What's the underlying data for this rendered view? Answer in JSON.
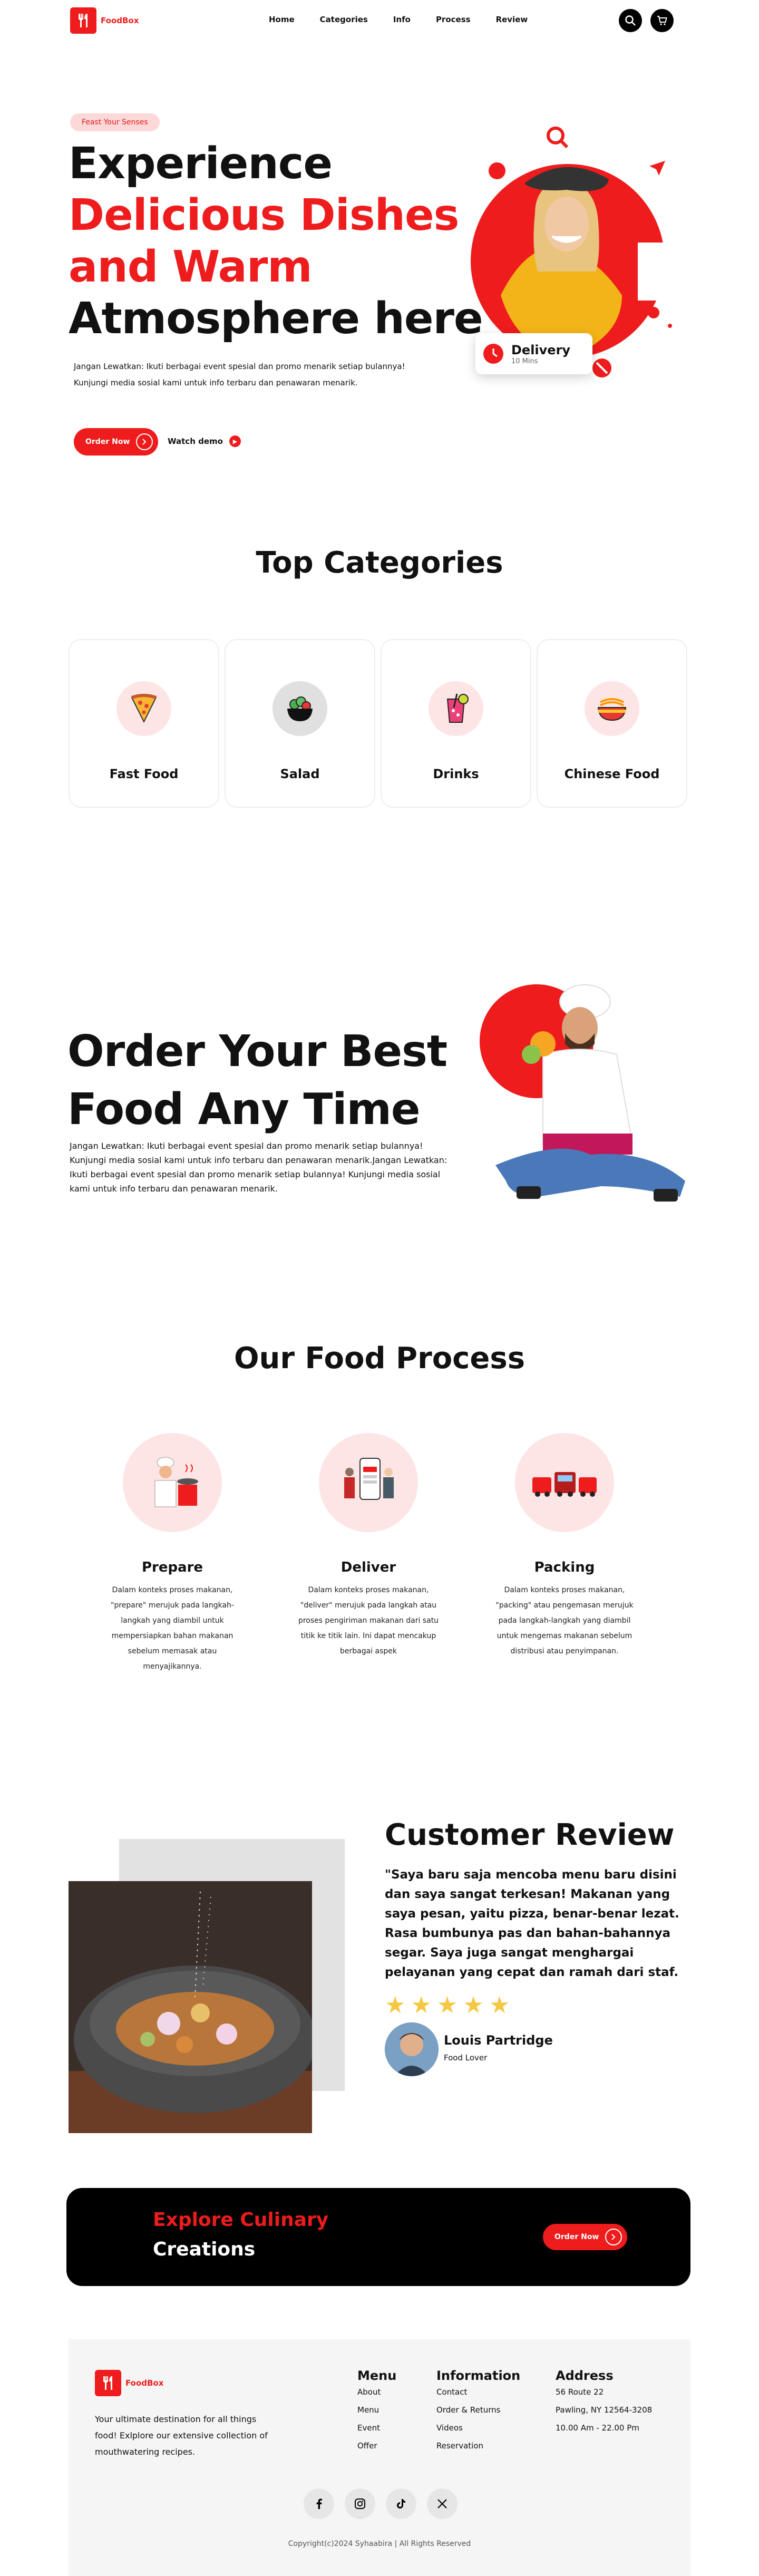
{
  "nav": {
    "brand": "FoodBox",
    "links": [
      "Home",
      "Categories",
      "Info",
      "Process",
      "Review"
    ]
  },
  "hero": {
    "pill": "Feast Your Senses",
    "line1": "Experience",
    "line2": "Delicious Dishes",
    "line3": "and Warm",
    "line4": "Atmosphere here",
    "paragraph1": "Jangan Lewatkan: Ikuti berbagai event spesial dan promo menarik setiap bulannya!",
    "paragraph2": "Kunjungi media sosial kami untuk info terbaru dan penawaran menarik.",
    "order_label": "Order Now",
    "watch_label": "Watch demo",
    "delivery_title": "Delivery",
    "delivery_time": "10 Mins"
  },
  "categories": {
    "title": "Top Categories",
    "items": [
      {
        "label": "Fast Food",
        "icon": "pizza-icon"
      },
      {
        "label": "Salad",
        "icon": "salad-icon"
      },
      {
        "label": "Drinks",
        "icon": "drink-icon"
      },
      {
        "label": "Chinese Food",
        "icon": "noodle-icon"
      }
    ]
  },
  "order": {
    "line1": "Order Your Best",
    "line2": "Food Any Time",
    "paragraph": "Jangan Lewatkan: Ikuti berbagai event spesial dan promo menarik setiap bulannya! Kunjungi media sosial kami untuk info terbaru dan penawaran menarik.Jangan Lewatkan: Ikuti berbagai event spesial dan promo menarik setiap bulannya! Kunjungi media sosial kami untuk info terbaru dan penawaran menarik."
  },
  "process": {
    "title": "Our Food Process",
    "items": [
      {
        "title": "Prepare",
        "text": "Dalam konteks proses makanan, \"prepare\" merujuk pada langkah-langkah yang diambil untuk mempersiapkan bahan makanan sebelum memasak atau menyajikannya."
      },
      {
        "title": "Deliver",
        "text": "Dalam konteks proses makanan, \"deliver\" merujuk pada langkah atau proses pengiriman makanan dari satu titik ke titik lain. Ini dapat mencakup berbagai aspek"
      },
      {
        "title": "Packing",
        "text": "Dalam konteks proses makanan, \"packing\" atau pengemasan merujuk pada langkah-langkah yang diambil untuk mengemas makanan sebelum distribusi atau penyimpanan."
      }
    ]
  },
  "review": {
    "title": "Customer Review",
    "text": "\"Saya baru saja mencoba menu baru disini dan saya sangat terkesan! Makanan yang saya pesan, yaitu pizza, benar-benar lezat. Rasa bumbunya pas dan bahan-bahannya segar. Saya juga sangat menghargai pelayanan yang cepat dan ramah dari staf.",
    "rating": 5,
    "name": "Louis Partridge",
    "role": "Food Lover"
  },
  "cta": {
    "line1": "Explore Culinary",
    "line2": "Creations",
    "button": "Order Now"
  },
  "footer": {
    "brand": "FoodBox",
    "desc": "Your ultimate destination for all things food! Exlplore our extensive collection of mouthwatering recipes.",
    "menu_title": "Menu",
    "menu_items": [
      "About",
      "Menu",
      "Event",
      "Offer"
    ],
    "info_title": "Information",
    "info_items": [
      "Contact",
      "Order & Returns",
      "Videos",
      "Reservation"
    ],
    "address_title": "Address",
    "address_lines": [
      "56 Route 22",
      "Pawling, NY 12564-3208",
      "10.00 Am - 22.00 Pm"
    ],
    "copyright": "Copyright(c)2024 Syhaabira | All Rights Reserved"
  },
  "colors": {
    "accent": "#ee1c1c",
    "pill_bg": "#fdd8d8",
    "dark": "#000000"
  }
}
